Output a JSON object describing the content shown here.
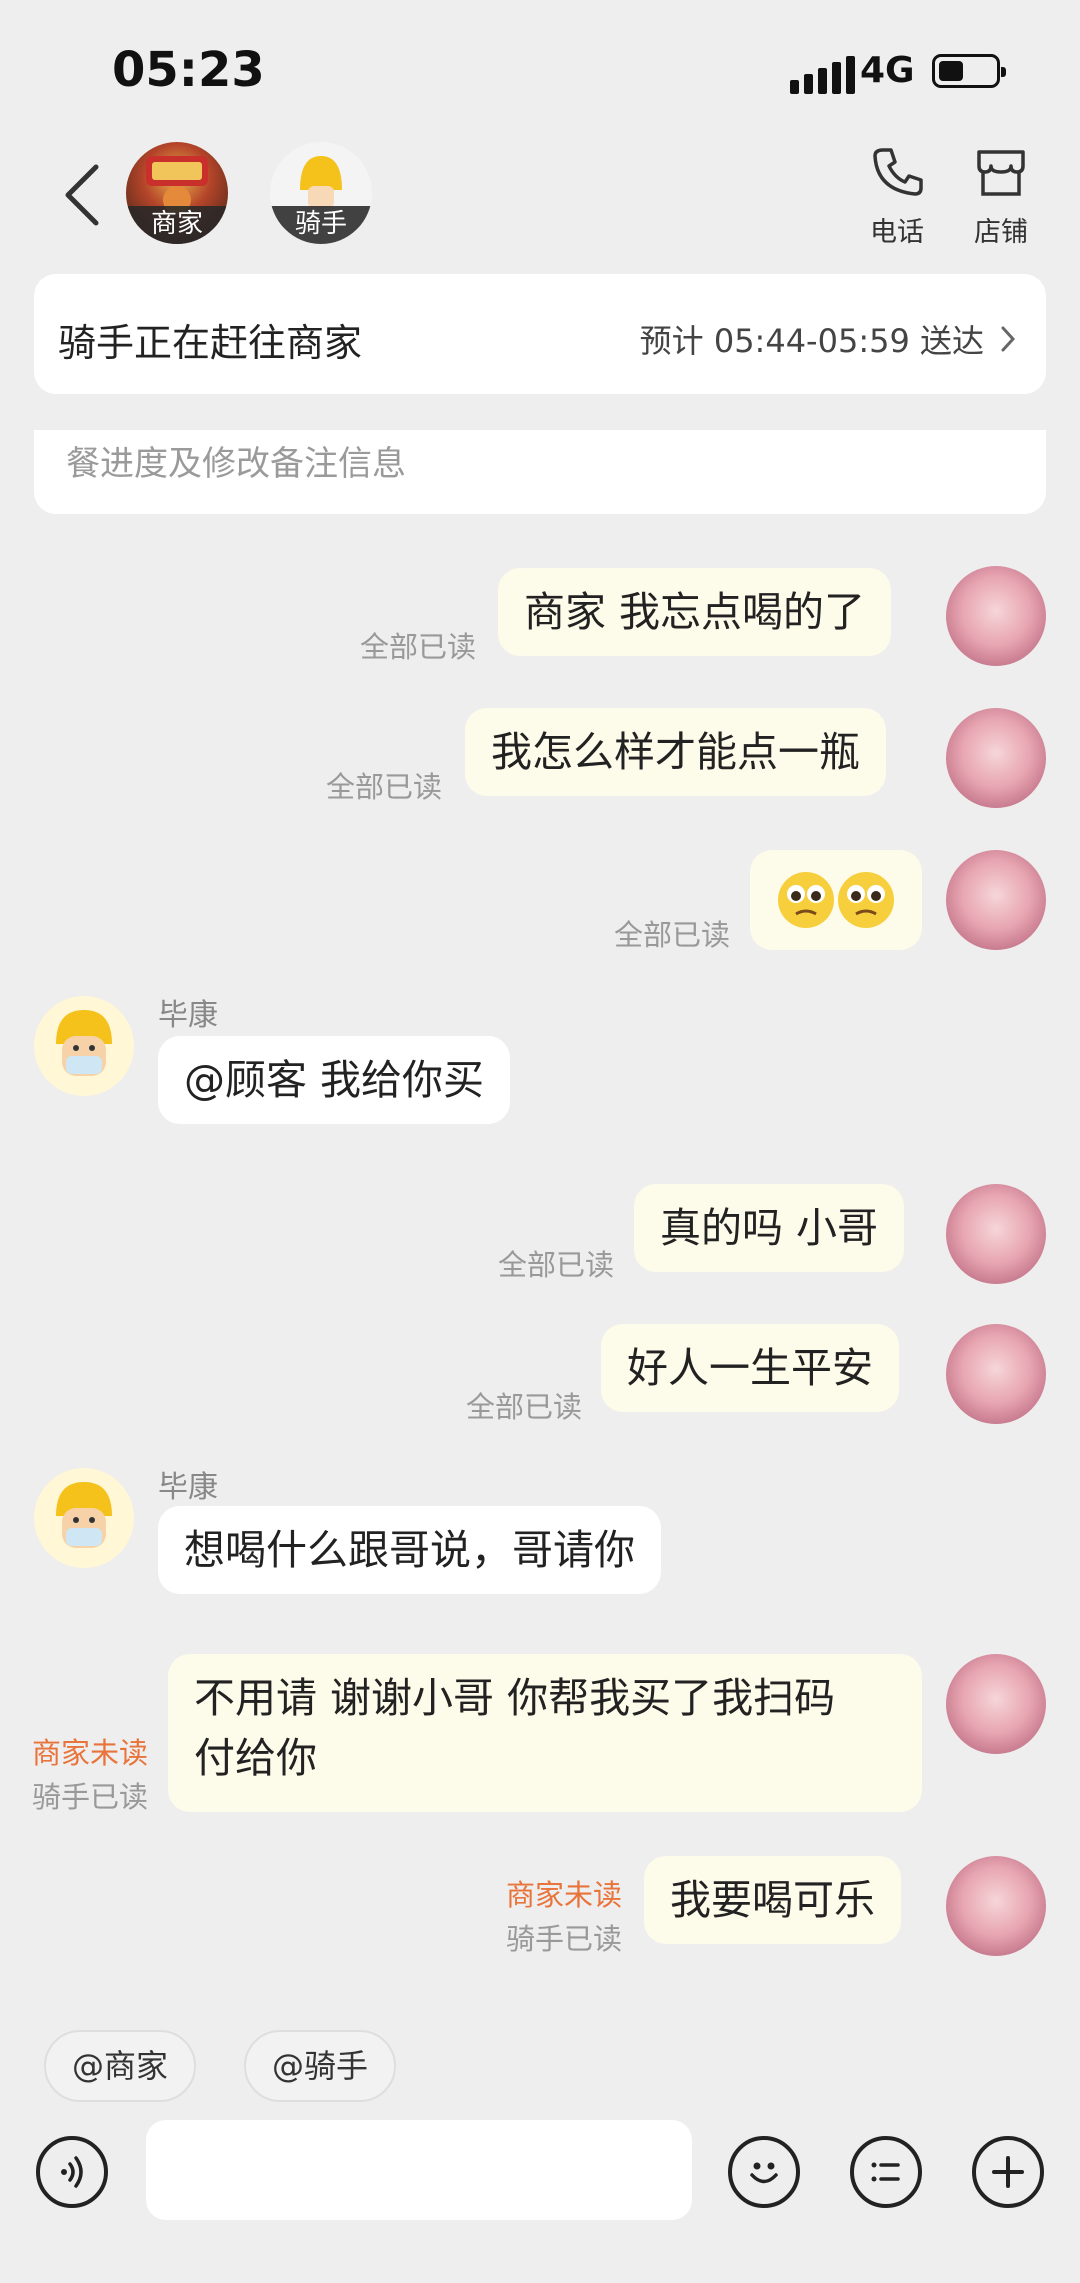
{
  "status_bar": {
    "time": "05:23",
    "network": "4G"
  },
  "header": {
    "merchant_label": "商家",
    "rider_label": "骑手",
    "phone_label": "电话",
    "store_label": "店铺"
  },
  "order_status": {
    "status": "骑手正在赶往商家",
    "eta": "预计 05:44-05:59 送达"
  },
  "notice": "餐进度及修改备注信息",
  "messages": [
    {
      "side": "me",
      "text": "商家 我忘点喝的了",
      "read": "全部已读"
    },
    {
      "side": "me",
      "text": "我怎么样才能点一瓶",
      "read": "全部已读"
    },
    {
      "side": "me",
      "text": "🥺🥺",
      "read": "全部已读"
    },
    {
      "side": "rider",
      "sender": "毕康",
      "text": "@顾客 我给你买"
    },
    {
      "side": "me",
      "text": "真的吗 小哥",
      "read": "全部已读"
    },
    {
      "side": "me",
      "text": "好人一生平安",
      "read": "全部已读"
    },
    {
      "side": "rider",
      "sender": "毕康",
      "text": "想喝什么跟哥说，哥请你"
    },
    {
      "side": "me",
      "text_line1": "不用请 谢谢小哥 你帮我买了我扫码",
      "text_line2": "付给你",
      "merchant_read": "商家未读",
      "rider_read": "骑手已读"
    },
    {
      "side": "me",
      "text": "我要喝可乐",
      "merchant_read": "商家未读",
      "rider_read": "骑手已读"
    }
  ],
  "quick_mentions": [
    "@商家",
    "@骑手"
  ],
  "input": {
    "placeholder": ""
  },
  "icons": [
    "back-icon",
    "phone-icon",
    "store-icon",
    "voice-icon",
    "emoji-icon",
    "quick-reply-icon",
    "plus-icon"
  ]
}
